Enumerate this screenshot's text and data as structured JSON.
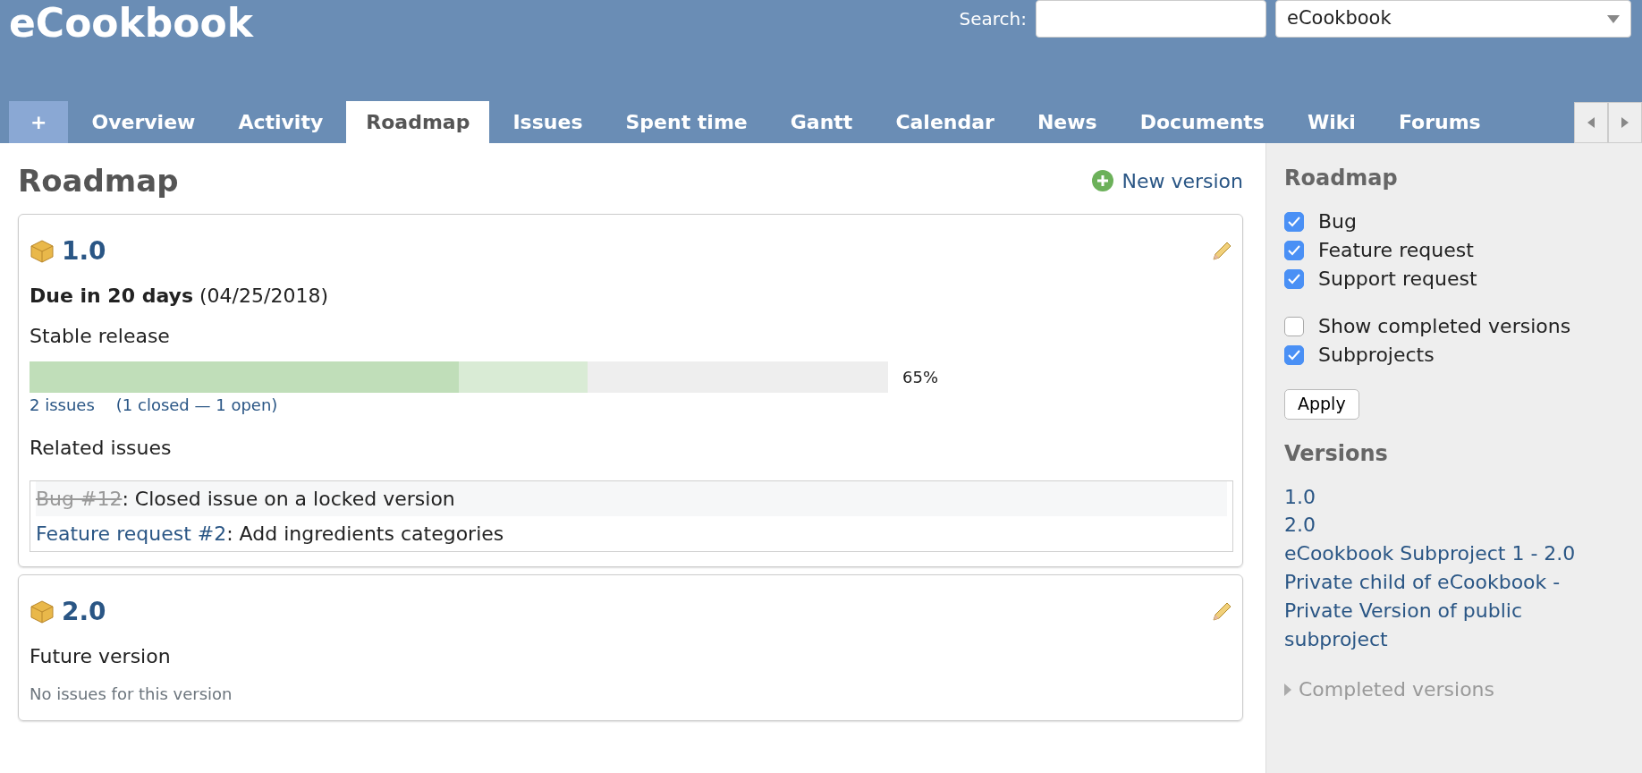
{
  "header": {
    "title": "eCookbook",
    "search_label": "Search:",
    "project_select": "eCookbook"
  },
  "tabs": [
    {
      "label": "+",
      "kind": "new",
      "selected": false
    },
    {
      "label": "Overview",
      "kind": "tab",
      "selected": false
    },
    {
      "label": "Activity",
      "kind": "tab",
      "selected": false
    },
    {
      "label": "Roadmap",
      "kind": "tab",
      "selected": true
    },
    {
      "label": "Issues",
      "kind": "tab",
      "selected": false
    },
    {
      "label": "Spent time",
      "kind": "tab",
      "selected": false
    },
    {
      "label": "Gantt",
      "kind": "tab",
      "selected": false
    },
    {
      "label": "Calendar",
      "kind": "tab",
      "selected": false
    },
    {
      "label": "News",
      "kind": "tab",
      "selected": false
    },
    {
      "label": "Documents",
      "kind": "tab",
      "selected": false
    },
    {
      "label": "Wiki",
      "kind": "tab",
      "selected": false
    },
    {
      "label": "Forums",
      "kind": "tab",
      "selected": false
    }
  ],
  "content": {
    "title": "Roadmap",
    "new_version": "New version",
    "versions": [
      {
        "name": "1.0",
        "due_bold": "Due in 20 days",
        "due_date": "(04/25/2018)",
        "description": "Stable release",
        "progress": {
          "closed": {
            "level": 0.5
          },
          "done": {
            "level": 0.65
          },
          "percent": "65%",
          "issues": "2 issues",
          "summary": "(1 closed — 1 open)"
        },
        "related_title": "Related issues",
        "issues": [
          {
            "link": "Bug #12",
            "subject": ": Closed issue on a locked version",
            "closed": true
          },
          {
            "link": "Feature request #2",
            "subject": ": Add ingredients categories",
            "closed": false
          }
        ]
      },
      {
        "name": "2.0",
        "description": "Future version",
        "no_issues": "No issues for this version"
      }
    ]
  },
  "sidebar": {
    "title": "Roadmap",
    "trackers": [
      {
        "label": "Bug",
        "checked": true
      },
      {
        "label": "Feature request",
        "checked": true
      },
      {
        "label": "Support request",
        "checked": true
      }
    ],
    "options": [
      {
        "label": "Show completed versions",
        "checked": false
      },
      {
        "label": "Subprojects",
        "checked": true
      }
    ],
    "apply": "Apply",
    "versions_title": "Versions",
    "versions": [
      "1.0",
      "2.0",
      "eCookbook Subproject 1 - 2.0",
      "Private child of eCookbook - Private Version of public subproject"
    ],
    "completed": "Completed versions"
  }
}
